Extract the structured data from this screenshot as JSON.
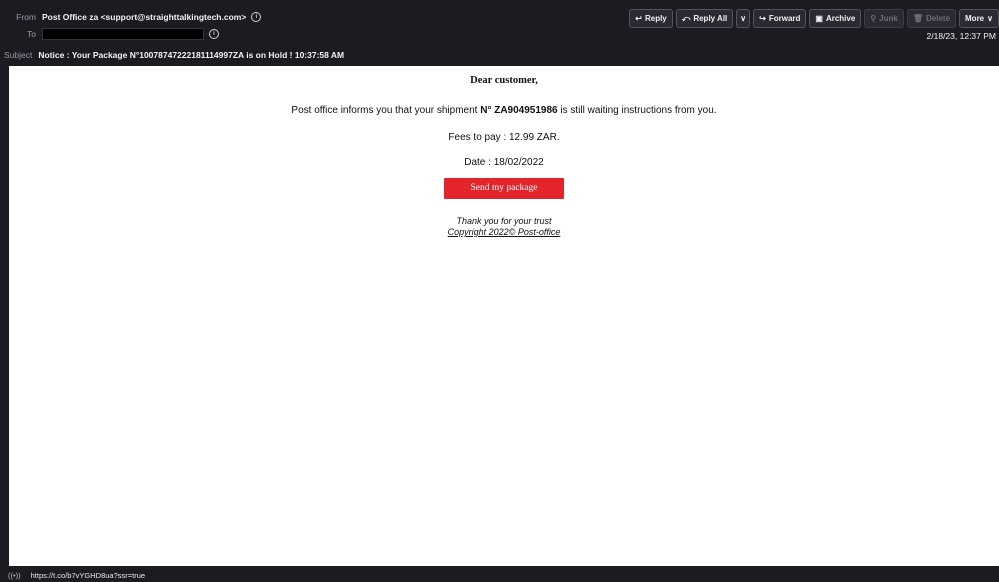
{
  "header": {
    "from_label": "From",
    "from_value": "Post Office za <support@straighttalkingtech.com>",
    "to_label": "To",
    "subject_label": "Subject",
    "subject_value": "Notice : Your Package N°10078747222181114997ZA is on Hold ! 10:37:58 AM",
    "date": "2/18/23, 12:37 PM",
    "info_glyph": "i"
  },
  "toolbar": {
    "reply": "Reply",
    "reply_all": "Reply All",
    "forward": "Forward",
    "archive": "Archive",
    "junk": "Junk",
    "delete": "Delete",
    "more": "More",
    "reply_icon": "↩",
    "reply_all_icon": "⤺",
    "forward_icon": "↪",
    "archive_icon": "▣",
    "junk_icon": "⚲",
    "delete_icon": "🗑",
    "dropdown_icon": "∨",
    "more_icon": "∨"
  },
  "email": {
    "greeting": "Dear customer,",
    "line1_pre": "Post office informs you that your shipment ",
    "line1_bold": "N° ZA904951986",
    "line1_post": " is still waiting instructions from you.",
    "fees": "Fees to pay : 12.99 ZAR.",
    "date": "Date : 18/02/2022",
    "button": "Send my package",
    "thanks": "Thank you for your trust",
    "copyright": "Copyright 2022© Post-office",
    "button_color": "#e3242b"
  },
  "status": {
    "icon": "((•))",
    "url": "https://t.co/b7vYGHD8ua?ssr=true"
  }
}
